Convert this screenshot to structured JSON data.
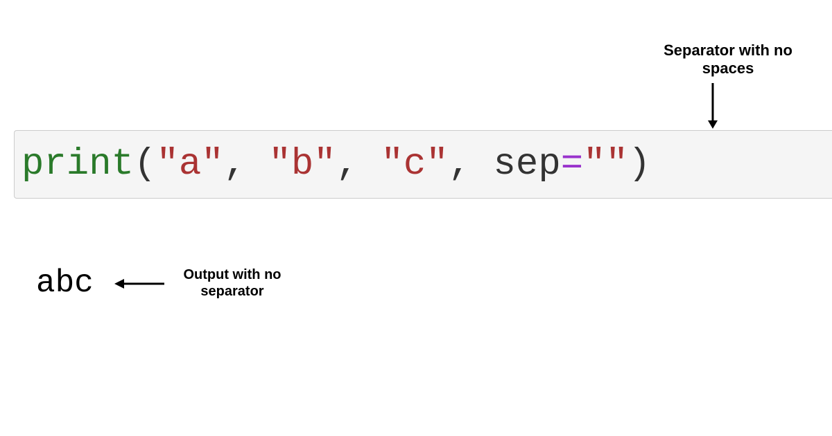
{
  "annotations": {
    "top": "Separator with no spaces",
    "output": "Output with no separator"
  },
  "code": {
    "func": "print",
    "open": "(",
    "arg1": "\"a\"",
    "comma": ", ",
    "arg2": "\"b\"",
    "arg3": "\"c\"",
    "kwarg": "sep",
    "equals": "=",
    "kwval": "\"\"",
    "close": ")"
  },
  "output": "abc"
}
